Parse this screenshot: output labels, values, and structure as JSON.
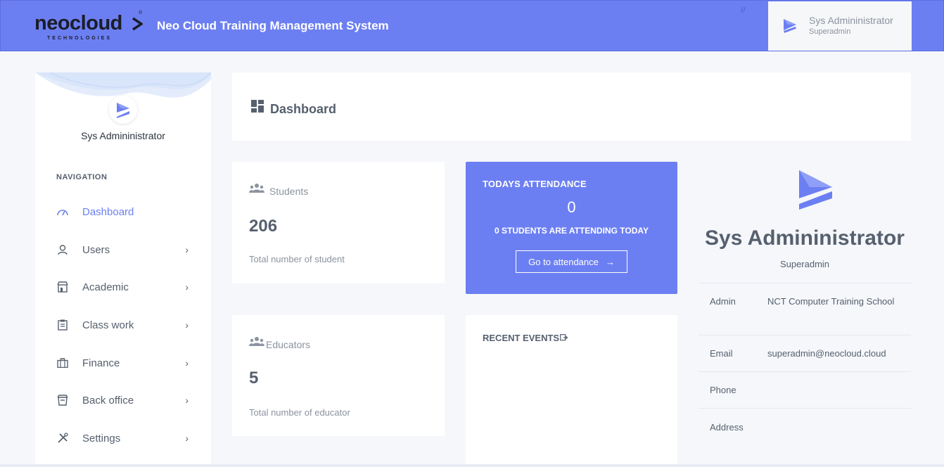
{
  "header": {
    "logo_word": "neocloud",
    "logo_sub": "TECHNOLOGIES",
    "logo_reg": "®",
    "app_title": "Neo Cloud Training Management System",
    "user_name": "Sys Admininistrator",
    "user_role": "Superadmin"
  },
  "sidebar": {
    "user_name": "Sys Admininistrator",
    "nav_heading": "NAVIGATION",
    "items": [
      {
        "label": "Dashboard",
        "icon": "gauge-icon",
        "active": true
      },
      {
        "label": "Users",
        "icon": "user-icon"
      },
      {
        "label": "Academic",
        "icon": "building-icon"
      },
      {
        "label": "Class work",
        "icon": "clipboard-icon"
      },
      {
        "label": "Finance",
        "icon": "briefcase-icon"
      },
      {
        "label": "Back office",
        "icon": "archive-icon"
      },
      {
        "label": "Settings",
        "icon": "tools-icon"
      }
    ]
  },
  "page": {
    "title": "Dashboard"
  },
  "stats": {
    "students": {
      "label": "Students",
      "value": "206",
      "foot": "Total number of student"
    },
    "educators": {
      "label": "Educators",
      "value": "5",
      "foot": "Total number of educator"
    }
  },
  "attendance": {
    "title": "TODAYS ATTENDANCE",
    "count": "0",
    "subtitle": "0 STUDENTS ARE ATTENDING TODAY",
    "button_label": "Go to attendance",
    "button_arrow": "→"
  },
  "events": {
    "title": "RECENT EVENTS"
  },
  "profile": {
    "name": "Sys Admininistrator",
    "role": "Superadmin",
    "fields": {
      "admin_key": "Admin",
      "admin_val": "NCT Computer Training School",
      "email_key": "Email",
      "email_val": "superadmin@neocloud.cloud",
      "phone_key": "Phone",
      "phone_val": "",
      "address_key": "Address",
      "address_val": ""
    }
  },
  "colors": {
    "brand": "#6c7ff2",
    "text": "#56606e",
    "muted": "#8b939f",
    "background": "#f5f7fb"
  }
}
